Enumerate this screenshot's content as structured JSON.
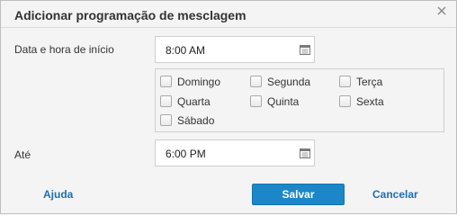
{
  "dialog": {
    "title": "Adicionar programação de mesclagem",
    "close_icon": "close-icon"
  },
  "start": {
    "label": "Data e hora de início",
    "value": "8:00 AM",
    "icon": "calendar-icon"
  },
  "days": [
    {
      "label": "Domingo",
      "checked": false
    },
    {
      "label": "Segunda",
      "checked": false
    },
    {
      "label": "Terça",
      "checked": false
    },
    {
      "label": "Quarta",
      "checked": false
    },
    {
      "label": "Quinta",
      "checked": false
    },
    {
      "label": "Sexta",
      "checked": false
    },
    {
      "label": "Sábado",
      "checked": false
    }
  ],
  "end": {
    "label": "Até",
    "value": "6:00 PM",
    "icon": "calendar-icon"
  },
  "footer": {
    "help_label": "Ajuda",
    "save_label": "Salvar",
    "cancel_label": "Cancelar"
  },
  "colors": {
    "accent": "#1b87c9",
    "link": "#1f6fb4"
  }
}
